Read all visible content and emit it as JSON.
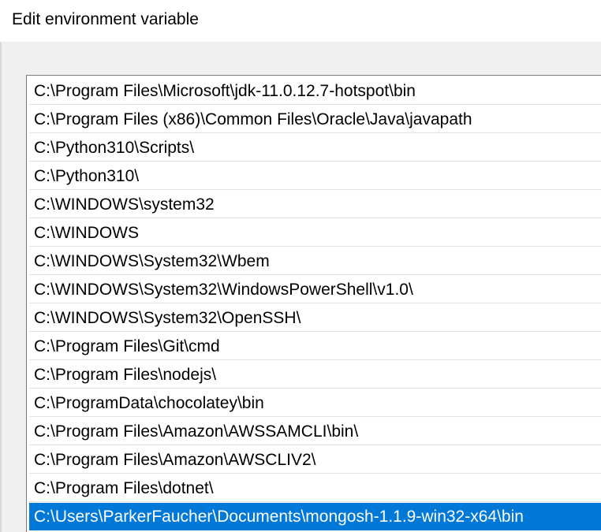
{
  "window": {
    "title": "Edit environment variable"
  },
  "path_entries": [
    {
      "value": "C:\\Program Files\\Microsoft\\jdk-11.0.12.7-hotspot\\bin",
      "selected": false
    },
    {
      "value": "C:\\Program Files (x86)\\Common Files\\Oracle\\Java\\javapath",
      "selected": false
    },
    {
      "value": "C:\\Python310\\Scripts\\",
      "selected": false
    },
    {
      "value": "C:\\Python310\\",
      "selected": false
    },
    {
      "value": "C:\\WINDOWS\\system32",
      "selected": false
    },
    {
      "value": "C:\\WINDOWS",
      "selected": false
    },
    {
      "value": "C:\\WINDOWS\\System32\\Wbem",
      "selected": false
    },
    {
      "value": "C:\\WINDOWS\\System32\\WindowsPowerShell\\v1.0\\",
      "selected": false
    },
    {
      "value": "C:\\WINDOWS\\System32\\OpenSSH\\",
      "selected": false
    },
    {
      "value": "C:\\Program Files\\Git\\cmd",
      "selected": false
    },
    {
      "value": "C:\\Program Files\\nodejs\\",
      "selected": false
    },
    {
      "value": "C:\\ProgramData\\chocolatey\\bin",
      "selected": false
    },
    {
      "value": "C:\\Program Files\\Amazon\\AWSSAMCLI\\bin\\",
      "selected": false
    },
    {
      "value": "C:\\Program Files\\Amazon\\AWSCLIV2\\",
      "selected": false
    },
    {
      "value": "C:\\Program Files\\dotnet\\",
      "selected": false
    },
    {
      "value": "C:\\Users\\ParkerFaucher\\Documents\\mongosh-1.1.9-win32-x64\\bin",
      "selected": true
    }
  ],
  "colors": {
    "selection_background": "#0078d7",
    "selection_text": "#ffffff"
  }
}
